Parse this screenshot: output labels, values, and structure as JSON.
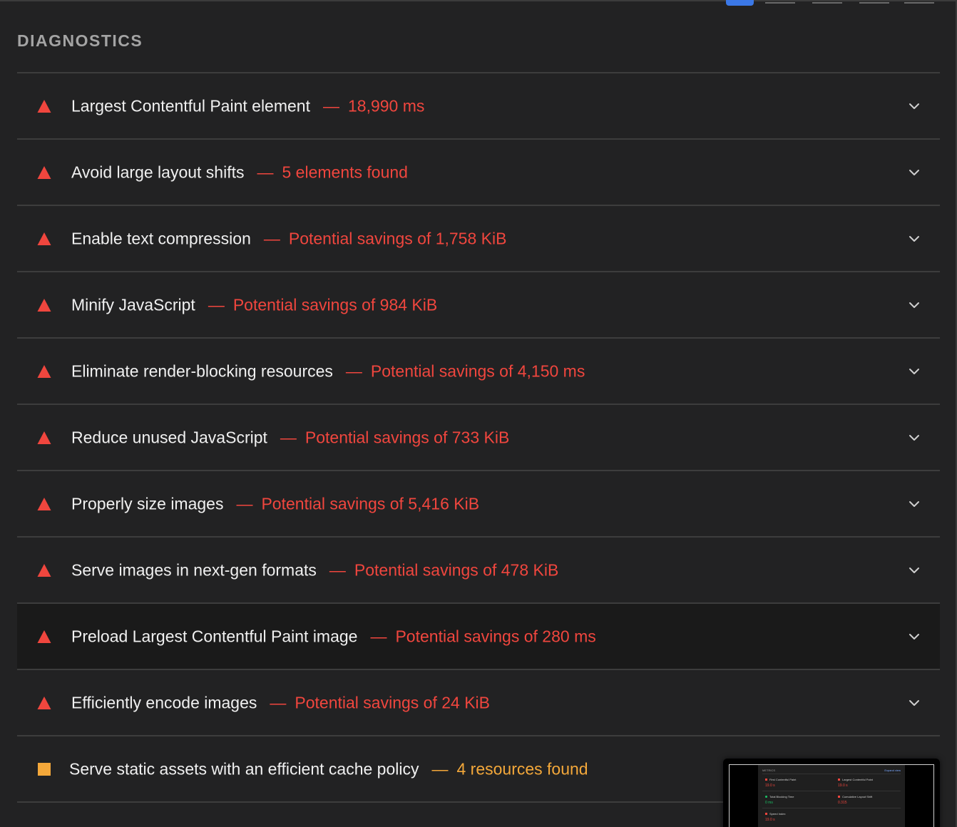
{
  "section": {
    "title": "DIAGNOSTICS"
  },
  "colors": {
    "fail": "#f0463e",
    "warn": "#f4a83a",
    "pass": "#1bc366",
    "accent": "#3b78e7"
  },
  "audits": [
    {
      "status": "fail",
      "icon": "fail-triangle-icon",
      "title": "Largest Contentful Paint element",
      "separator": "—",
      "value": "18,990 ms"
    },
    {
      "status": "fail",
      "icon": "fail-triangle-icon",
      "title": "Avoid large layout shifts",
      "separator": "—",
      "value": "5 elements found"
    },
    {
      "status": "fail",
      "icon": "fail-triangle-icon",
      "title": "Enable text compression",
      "separator": "—",
      "value": "Potential savings of 1,758 KiB"
    },
    {
      "status": "fail",
      "icon": "fail-triangle-icon",
      "title": "Minify JavaScript",
      "separator": "—",
      "value": "Potential savings of 984 KiB"
    },
    {
      "status": "fail",
      "icon": "fail-triangle-icon",
      "title": "Eliminate render-blocking resources",
      "separator": "—",
      "value": "Potential savings of 4,150 ms"
    },
    {
      "status": "fail",
      "icon": "fail-triangle-icon",
      "title": "Reduce unused JavaScript",
      "separator": "—",
      "value": "Potential savings of 733 KiB"
    },
    {
      "status": "fail",
      "icon": "fail-triangle-icon",
      "title": "Properly size images",
      "separator": "—",
      "value": "Potential savings of 5,416 KiB"
    },
    {
      "status": "fail",
      "icon": "fail-triangle-icon",
      "title": "Serve images in next-gen formats",
      "separator": "—",
      "value": "Potential savings of 478 KiB"
    },
    {
      "status": "fail",
      "icon": "fail-triangle-icon",
      "title": "Preload Largest Contentful Paint image",
      "separator": "—",
      "value": "Potential savings of 280 ms",
      "highlighted": true
    },
    {
      "status": "fail",
      "icon": "fail-triangle-icon",
      "title": "Efficiently encode images",
      "separator": "—",
      "value": "Potential savings of 24 KiB"
    },
    {
      "status": "warn",
      "icon": "warn-square-icon",
      "title": "Serve static assets with an efficient cache policy",
      "separator": "—",
      "value": "4 resources found"
    }
  ],
  "thumbnail": {
    "header": "METRICS",
    "link": "Expand view",
    "metrics": [
      {
        "label": "First Contentful Paint",
        "value": "19.0 s",
        "status": "fail"
      },
      {
        "label": "Largest Contentful Paint",
        "value": "19.0 s",
        "status": "fail"
      },
      {
        "label": "Total Blocking Time",
        "value": "0 ms",
        "status": "pass"
      },
      {
        "label": "Cumulative Layout Shift",
        "value": "0.315",
        "status": "fail"
      },
      {
        "label": "Speed Index",
        "value": "19.0 s",
        "status": "fail"
      }
    ]
  }
}
